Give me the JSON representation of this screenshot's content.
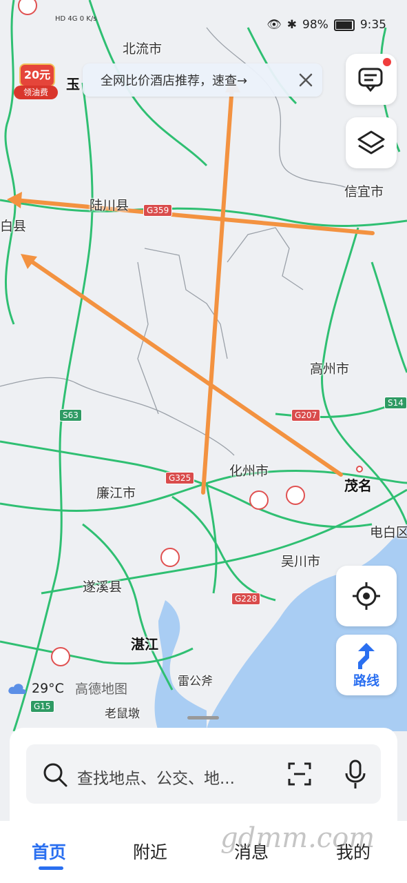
{
  "status_bar": {
    "signal_left": "HD 4G",
    "net_speed_value": "0",
    "net_speed_unit": "K/s",
    "battery": "98%",
    "time": "9:35"
  },
  "banner": {
    "text": "全网比价酒店推荐，速查→"
  },
  "coupon": {
    "amount": "20元",
    "label": "领油费"
  },
  "map_labels": {
    "beiliu": "北流市",
    "yu": "玉",
    "luchuan": "陆川县",
    "xinyi": "信宜市",
    "bai": "白县",
    "gaozhou": "高州市",
    "huazhou": "化州市",
    "maoming": "茂名",
    "lianjiang": "廉江市",
    "dianbai": "电白区",
    "wuchuan": "吴川市",
    "suixi": "遂溪县",
    "zhanjiang": "湛江",
    "leigongfu": "雷公斧",
    "laoshudun": "老鼠墩"
  },
  "road_shields": {
    "g359": "G359",
    "s63": "S63",
    "g207": "G207",
    "s14": "S14",
    "g325": "G325",
    "g228": "G228",
    "g15": "G15"
  },
  "side_buttons": {
    "route_label": "路线"
  },
  "weather": {
    "temp": "29°C",
    "brand": "高德地图"
  },
  "search": {
    "placeholder": "查找地点、公交、地..."
  },
  "tabs": [
    {
      "label": "首页",
      "active": true
    },
    {
      "label": "附近",
      "active": false
    },
    {
      "label": "消息",
      "active": false
    },
    {
      "label": "我的",
      "active": false
    }
  ],
  "watermark": "gdmm.com",
  "colors": {
    "accent": "#2a6ff0",
    "road": "#2fbf72",
    "arrow": "#f39240",
    "sea": "#a9cdf3"
  }
}
